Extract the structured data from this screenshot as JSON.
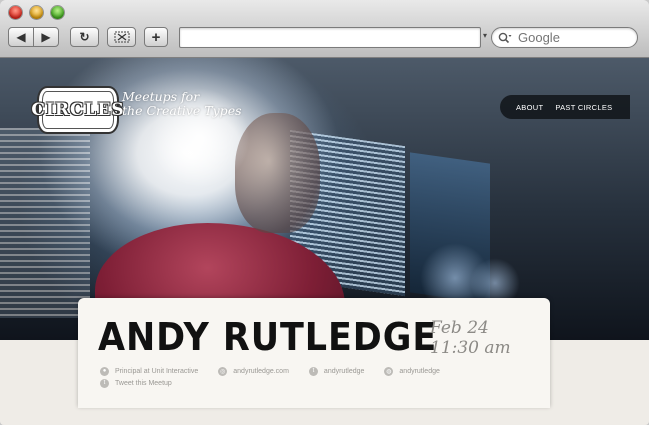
{
  "browser": {
    "search": {
      "placeholder": "Google"
    },
    "address": {
      "value": ""
    },
    "buttons": {
      "back": "◀",
      "forward": "▶",
      "reload": "↻",
      "add": "+"
    }
  },
  "site": {
    "logo_text": "CIRCLES",
    "tagline_line1": "Meetups for",
    "tagline_line2": "the Creative Types",
    "nav": [
      "ABOUT",
      "PAST CIRCLES"
    ]
  },
  "event": {
    "speaker": "ANDY RUTLEDGE",
    "date": "Feb 24",
    "time": "11:30 am",
    "meta": [
      {
        "icon": "person-icon",
        "text": "Principal at Unit Interactive"
      },
      {
        "icon": "globe-icon",
        "text": "andyrutledge.com"
      },
      {
        "icon": "twitter-icon",
        "text": "andyrutledge"
      },
      {
        "icon": "dribbble-icon",
        "text": "andyrutledge"
      }
    ],
    "tweet": {
      "icon": "twitter-icon",
      "text": "Tweet this Meetup"
    }
  }
}
